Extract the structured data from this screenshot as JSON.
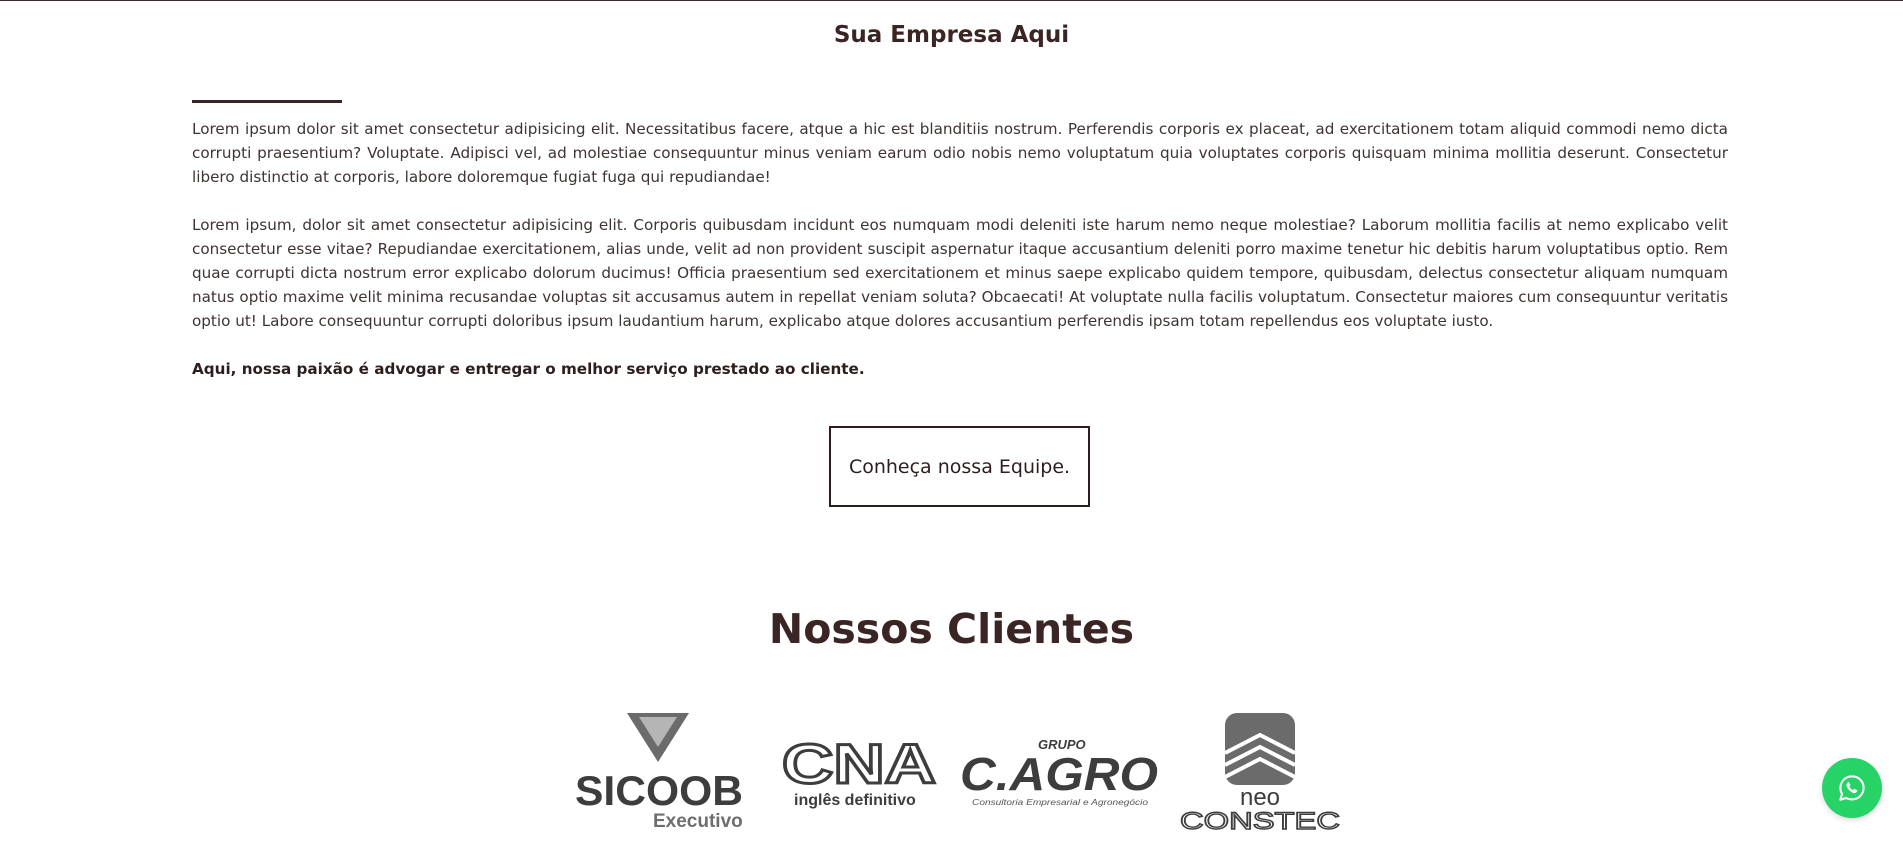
{
  "about": {
    "title": "Sua Empresa Aqui",
    "paragraphs": [
      "Lorem ipsum dolor sit amet consectetur adipisicing elit. Necessitatibus facere, atque a hic est blanditiis nostrum. Perferendis corporis ex placeat, ad exercitationem totam aliquid commodi nemo dicta corrupti praesentium? Voluptate. Adipisci vel, ad molestiae consequuntur minus veniam earum odio nobis nemo voluptatum quia voluptates corporis quisquam minima mollitia deserunt. Consectetur libero distinctio at corporis, labore doloremque fugiat fuga qui repudiandae!",
      "Lorem ipsum, dolor sit amet consectetur adipisicing elit. Corporis quibusdam incidunt eos numquam modi deleniti iste harum nemo neque molestiae? Laborum mollitia facilis at nemo explicabo velit consectetur esse vitae? Repudiandae exercitationem, alias unde, velit ad non provident suscipit aspernatur itaque accusantium deleniti porro maxime tenetur hic debitis harum voluptatibus optio. Rem quae corrupti dicta nostrum error explicabo dolorum ducimus! Officia praesentium sed exercitationem et minus saepe explicabo quidem tempore, quibusdam, delectus consectetur aliquam numquam natus optio maxime velit minima recusandae voluptas sit accusamus autem in repellat veniam soluta? Obcaecati! At voluptate nulla facilis voluptatum. Consectetur maiores cum consequuntur veritatis optio ut! Labore consequuntur corrupti doloribus ipsum laudantium harum, explicabo atque dolores accusantium perferendis ipsam totam repellendus eos voluptate iusto."
    ],
    "highlight": "Aqui, nossa paixão é advogar e entregar o melhor serviço prestado ao cliente.",
    "team_button": "Conheça nossa Equipe."
  },
  "clients": {
    "title": "Nossos Clientes",
    "logos": [
      {
        "name": "SICOOB",
        "sub": "Executivo"
      },
      {
        "name": "CNA",
        "sub": "inglês definitivo"
      },
      {
        "name": "C.AGRO",
        "top": "GRUPO",
        "sub": "Consultoria Empresarial e Agronegócio"
      },
      {
        "name": "neo",
        "sub": "CONSTEC"
      }
    ]
  },
  "whatsapp": {
    "icon": "whatsapp-icon"
  },
  "colors": {
    "text": "#3a2424",
    "whatsapp": "#25d366"
  }
}
